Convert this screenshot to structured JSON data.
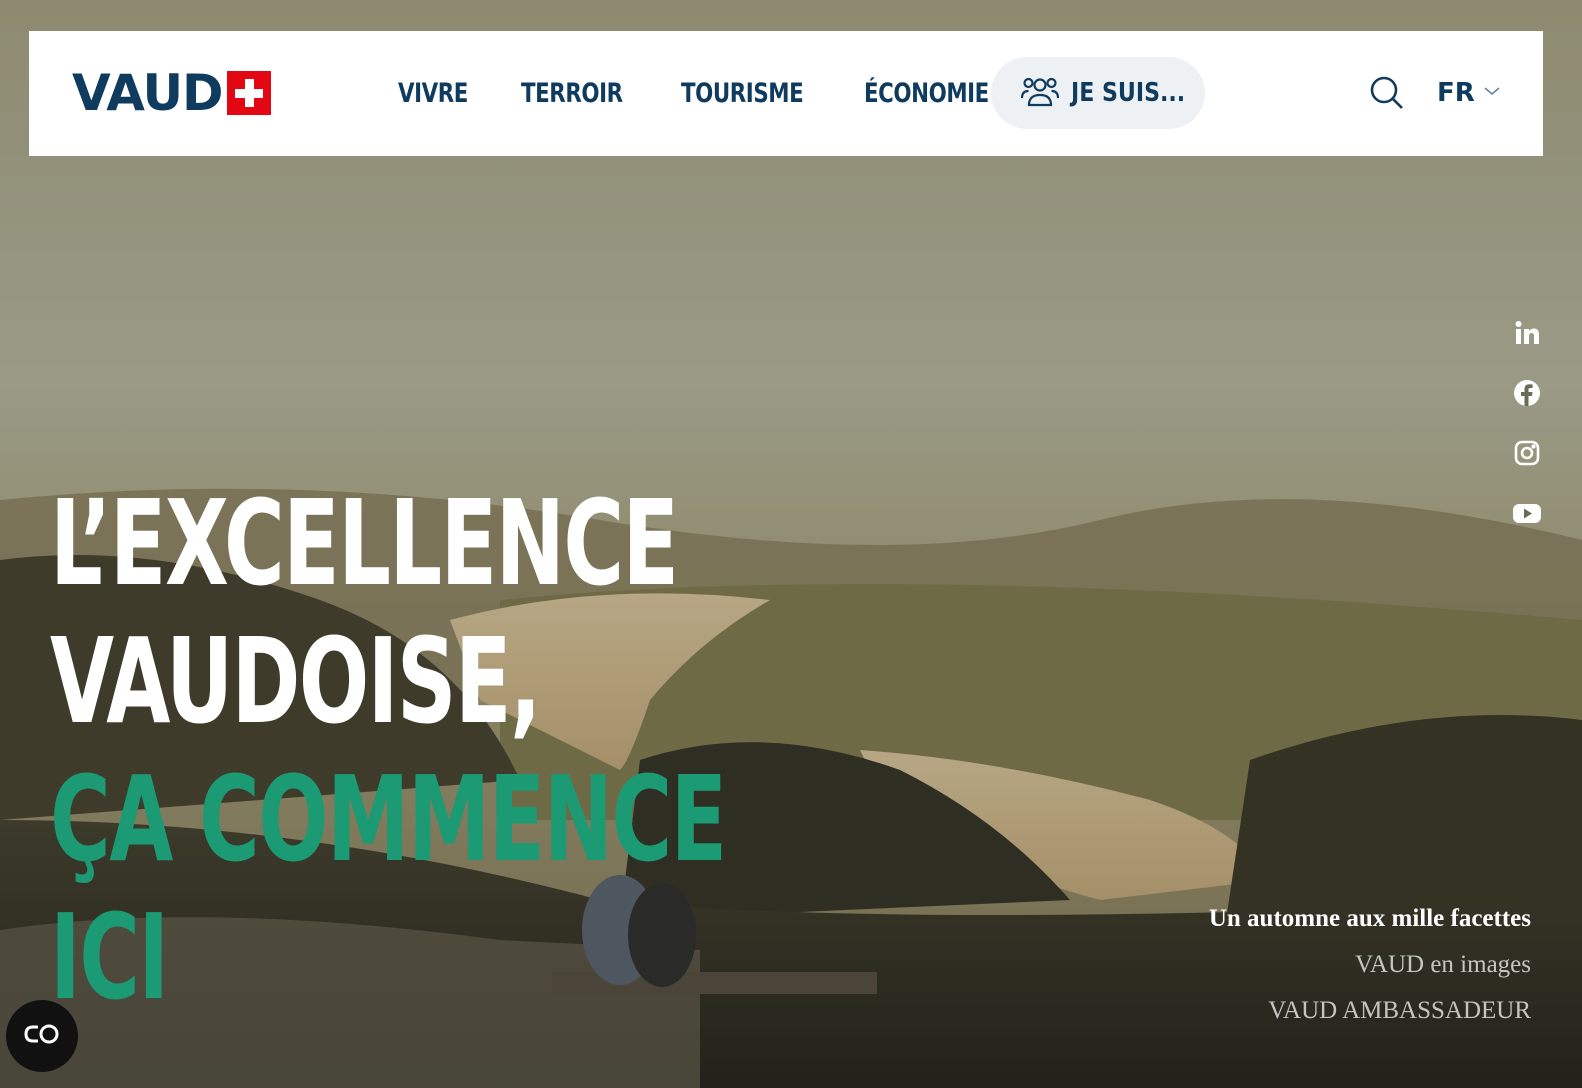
{
  "header": {
    "logo_text": "VAUD",
    "nav": [
      {
        "label": "VIVRE"
      },
      {
        "label": "TERROIR"
      },
      {
        "label": "TOURISME"
      },
      {
        "label": "ÉCONOMIE"
      }
    ],
    "je_suis_label": "JE SUIS...",
    "language": "FR"
  },
  "hero": {
    "headline_white": [
      "L’EXCELLENCE",
      "VAUDOISE,"
    ],
    "headline_green": [
      "ÇA COMMENCE",
      "ICI"
    ]
  },
  "social": [
    "linkedin-icon",
    "facebook-icon",
    "instagram-icon",
    "youtube-icon"
  ],
  "slides": [
    {
      "label": "Un automne aux mille facettes",
      "active": true
    },
    {
      "label": "VAUD en images",
      "active": false
    },
    {
      "label": "VAUD AMBASSADEUR",
      "active": false
    }
  ],
  "colors": {
    "brand_navy": "#0f3b5f",
    "brand_red": "#e30613",
    "accent_green": "#1b9a74"
  }
}
